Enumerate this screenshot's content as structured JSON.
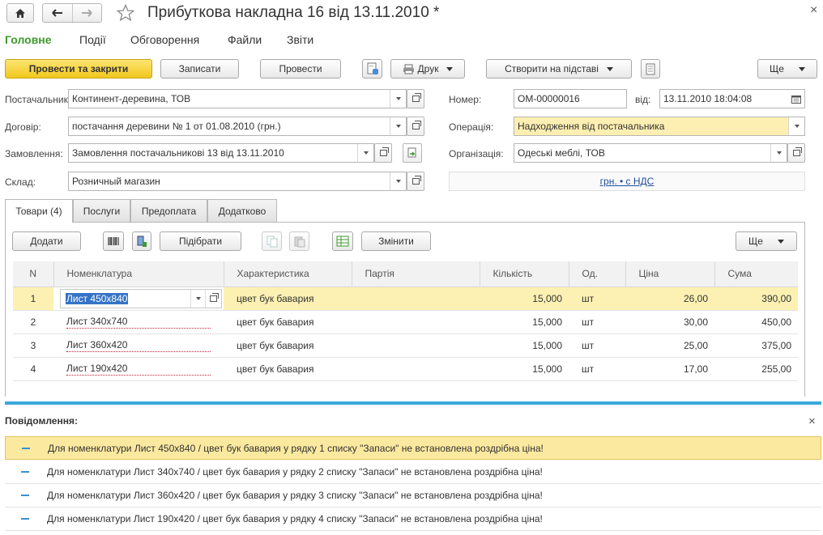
{
  "window": {
    "title": "Прибуткова накладна 16 від 13.11.2010 *"
  },
  "menu": [
    "Головне",
    "Події",
    "Обговорення",
    "Файли",
    "Звіти"
  ],
  "toolbar": {
    "post_close": "Провести та закрити",
    "save": "Записати",
    "post": "Провести",
    "print": "Друк",
    "create_based": "Створити на підставі",
    "more": "Ще"
  },
  "form": {
    "supplier_label": "Постачальник:",
    "supplier": "Континент-деревина, ТОВ",
    "contract_label": "Договір:",
    "contract": "постачання деревини № 1 от 01.08.2010 (грн.)",
    "order_label": "Замовлення:",
    "order": "Замовлення постачальникові 13 від 13.11.2010",
    "warehouse_label": "Склад:",
    "warehouse": "Розничный магазин",
    "number_label": "Номер:",
    "number": "ОМ-00000016",
    "date_label": "від:",
    "date": "13.11.2010 18:04:08",
    "operation_label": "Операція:",
    "operation": "Надходження від постачальника",
    "org_label": "Організація:",
    "org": "Одеські меблі, ТОВ",
    "currency_link": "грн. • с НДС"
  },
  "tabs": [
    "Товари (4)",
    "Послуги",
    "Предоплата",
    "Додатково"
  ],
  "table_toolbar": {
    "add": "Додати",
    "pick": "Підібрати",
    "change": "Змінити",
    "more": "Ще"
  },
  "table": {
    "headers": [
      "N",
      "Номенклатура",
      "Характеристика",
      "Партія",
      "Кількість",
      "Од.",
      "Ціна",
      "Сума"
    ],
    "rows": [
      {
        "n": "1",
        "item": "Лист 450х840",
        "char": "цвет бук бавария",
        "batch": "",
        "qty": "15,000",
        "unit": "шт",
        "price": "26,00",
        "sum": "390,00"
      },
      {
        "n": "2",
        "item": "Лист 340х740",
        "char": "цвет бук бавария",
        "batch": "",
        "qty": "15,000",
        "unit": "шт",
        "price": "30,00",
        "sum": "450,00"
      },
      {
        "n": "3",
        "item": "Лист 360х420",
        "char": "цвет бук бавария",
        "batch": "",
        "qty": "15,000",
        "unit": "шт",
        "price": "25,00",
        "sum": "375,00"
      },
      {
        "n": "4",
        "item": "Лист 190х420",
        "char": "цвет бук бавария",
        "batch": "",
        "qty": "15,000",
        "unit": "шт",
        "price": "17,00",
        "sum": "255,00"
      }
    ]
  },
  "messages": {
    "title": "Повідомлення:",
    "items": [
      "Для номенклатури Лист 450х840 / цвет бук бавария у рядку 1 списку \"Запаси\" не встановлена роздрібна ціна!",
      "Для номенклатури Лист 340х740 / цвет бук бавария у рядку 2 списку \"Запаси\" не встановлена роздрібна ціна!",
      "Для номенклатури Лист 360х420 / цвет бук бавария у рядку 3 списку \"Запаси\" не встановлена роздрібна ціна!",
      "Для номенклатури Лист 190х420 / цвет бук бавария у рядку 4 списку \"Запаси\" не встановлена роздрібна ціна!"
    ]
  },
  "colors": {
    "accent_green": "#3f9a2e",
    "primary_yellow": "#f2c81d",
    "selection": "#fcf1b3",
    "divider_blue": "#39a9dc",
    "link": "#1f4fa0"
  }
}
